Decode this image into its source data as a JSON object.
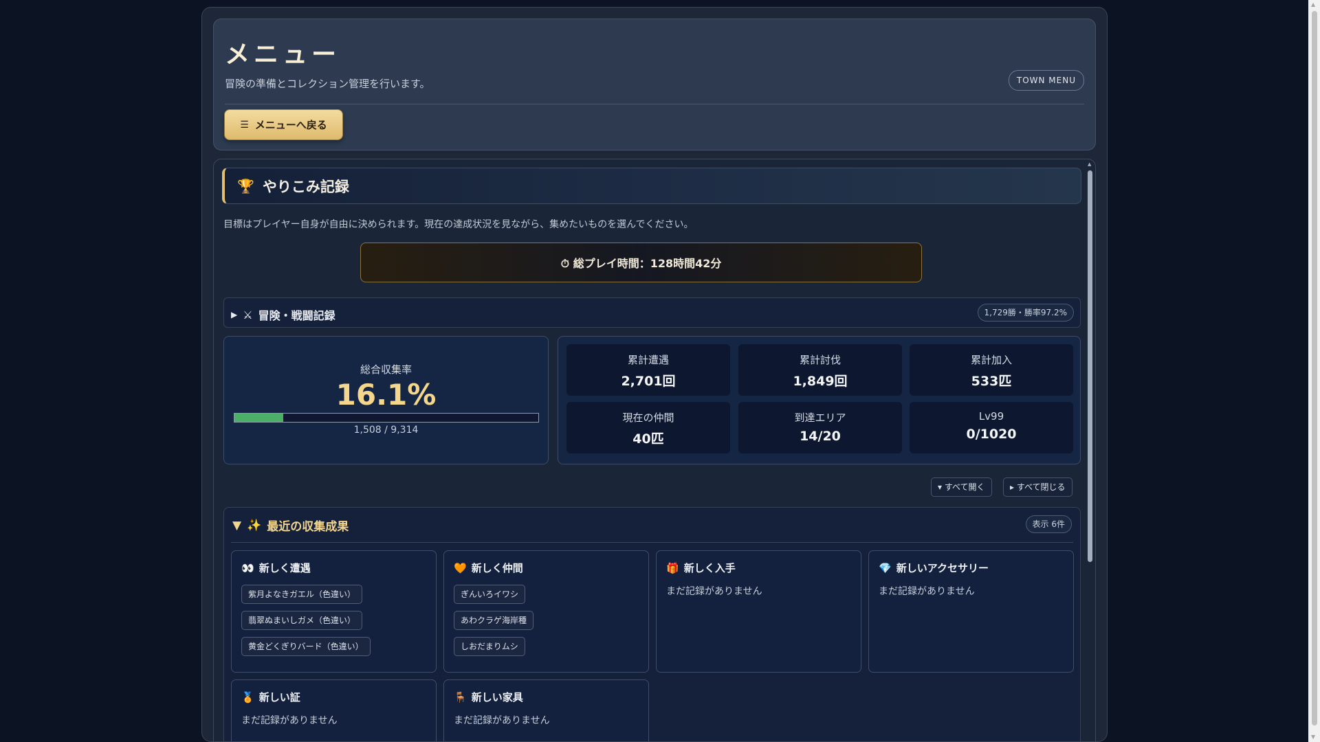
{
  "header": {
    "title": "メニュー",
    "subtitle": "冒険の準備とコレクション管理を行います。",
    "badge": "TOWN MENU",
    "back_button": "メニューへ戻る"
  },
  "records": {
    "title": "やりこみ記録",
    "description": "目標はプレイヤー自身が自由に決められます。現在の達成状況を見ながら、集めたいものを選んでください。",
    "playtime": "⏱ 総プレイ時間：128時間42分",
    "adventure": {
      "title": "冒険・戦闘記録",
      "badge": "1,729勝・勝率97.2%"
    },
    "collection": {
      "label": "総合収集率",
      "percent_text": "16.1%",
      "progress": 0.161,
      "count": "1,508 / 9,314"
    },
    "stats": [
      {
        "label": "累計遭遇",
        "value": "2,701回"
      },
      {
        "label": "累計討伐",
        "value": "1,849回"
      },
      {
        "label": "累計加入",
        "value": "533匹"
      },
      {
        "label": "現在の仲間",
        "value": "40匹"
      },
      {
        "label": "到達エリア",
        "value": "14/20"
      },
      {
        "label": "Lv99",
        "value": "0/1020"
      }
    ],
    "expand_all": "▾ すべて開く",
    "collapse_all": "▸ すべて閉じる"
  },
  "recent": {
    "title": "最近の収集成果",
    "badge": "表示 6件",
    "empty_text": "まだ記録がありません",
    "boxes": [
      {
        "title": "新しく遭遇",
        "icon": "eyes-icon",
        "items": [
          "紫月よなきガエル（色違い）",
          "翡翠ぬまいしガメ（色違い）",
          "黄金どくぎりバード（色違い）"
        ]
      },
      {
        "title": "新しく仲間",
        "icon": "heart-icon",
        "items": [
          "ぎんいろイワシ",
          "あわクラゲ海岸種",
          "しおだまりムシ"
        ]
      },
      {
        "title": "新しく入手",
        "icon": "gift-icon",
        "items": []
      },
      {
        "title": "新しいアクセサリー",
        "icon": "gem-icon",
        "items": []
      },
      {
        "title": "新しい証",
        "icon": "medal-icon",
        "items": []
      },
      {
        "title": "新しい家具",
        "icon": "chair-icon",
        "items": []
      }
    ]
  },
  "colors": {
    "accent_gold": "#e3bf6e",
    "progress_green": "#4caf68",
    "background": "#0c1424"
  }
}
